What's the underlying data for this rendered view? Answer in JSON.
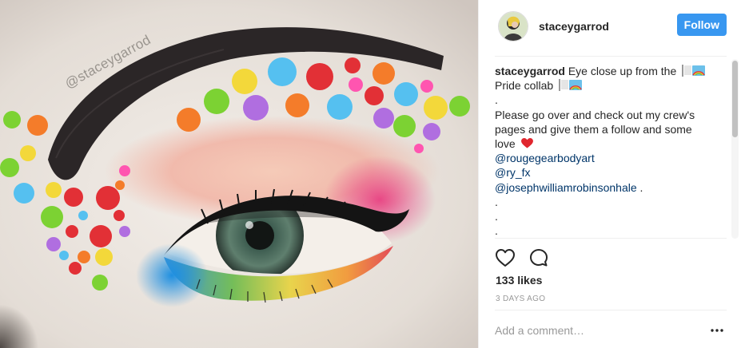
{
  "post": {
    "username": "staceygarrod",
    "follow_label": "Follow",
    "watermark": "@staceygarrod",
    "caption": {
      "username": "staceygarrod",
      "text_part1": "Eye close up from the",
      "text_part2": "Pride collab",
      "dot": ".",
      "body1": "Please go over and check out my crew's",
      "body2": "pages and give them a follow and some",
      "body3": "love",
      "mentions": [
        "@rougegearbodyart",
        "@ry_fx",
        "@josephwilliamrobinsonhale"
      ],
      "mention_suffix": " .",
      "trailing_dots": [
        ".",
        ".",
        "."
      ]
    },
    "likes": "133 likes",
    "timestamp": "3 DAYS AGO",
    "comment_placeholder": "Add a comment…"
  },
  "icons": {
    "like": "heart-outline-icon",
    "comment": "comment-bubble-icon",
    "more": "more-options-icon",
    "flag": "rainbow-flag-emoji",
    "heart": "red-heart-emoji"
  },
  "colors": {
    "follow_button": "#3897f0",
    "mention": "#003569",
    "muted_text": "#999999"
  }
}
